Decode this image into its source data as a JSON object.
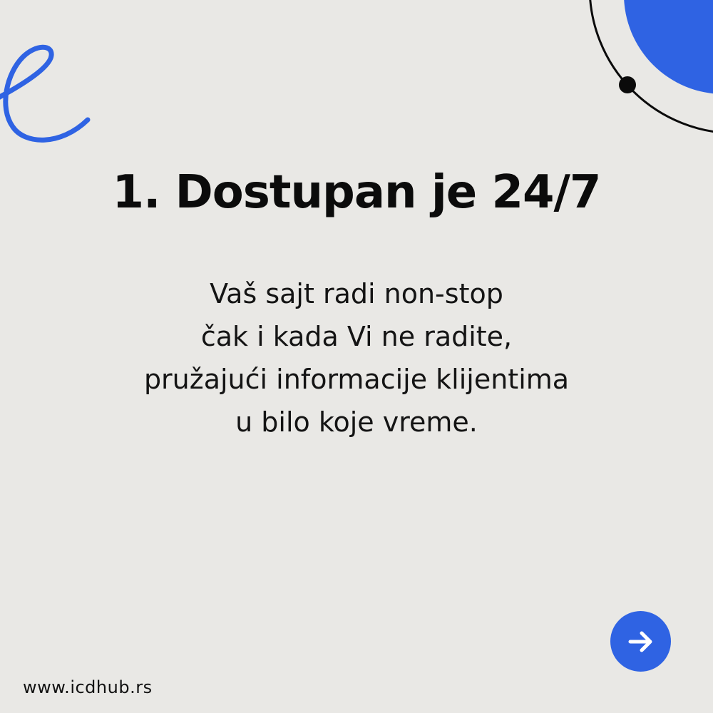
{
  "slide": {
    "title": "1. Dostupan je 24/7",
    "body_lines": [
      "Vaš sajt radi non-stop",
      "čak i kada Vi ne radite,",
      "pružajući informacije klijentima",
      "u bilo koje vreme."
    ]
  },
  "footer": {
    "url": "www.icdhub.rs"
  },
  "next_button": {
    "icon": "arrow-right-icon"
  },
  "colors": {
    "background": "#e9e8e5",
    "accent_blue": "#2f63e3",
    "text": "#0b0b0b"
  }
}
